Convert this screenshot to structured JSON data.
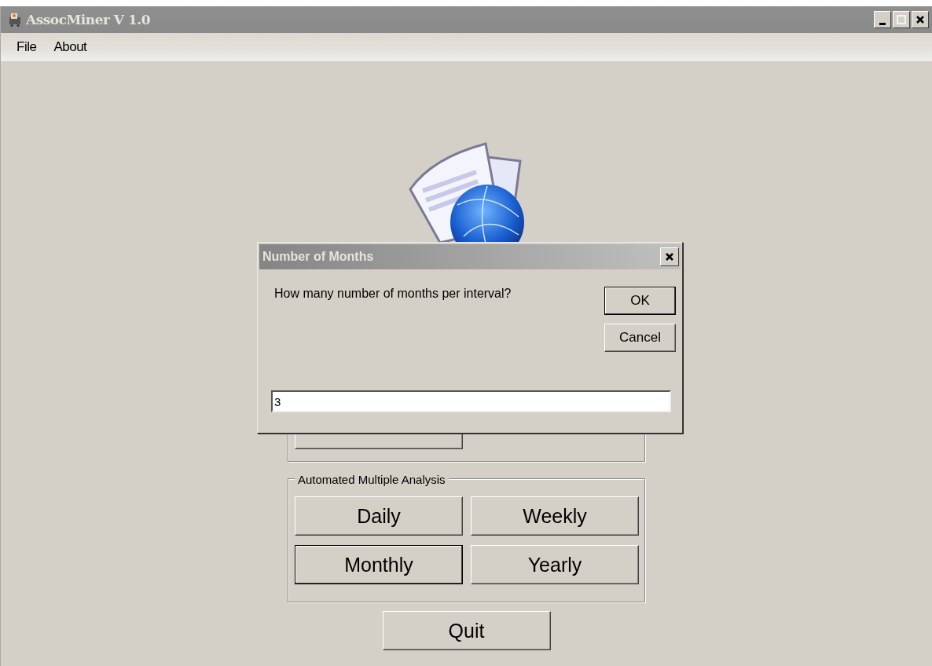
{
  "window": {
    "title": "AssocMiner V 1.0"
  },
  "menu": [
    "File",
    "About"
  ],
  "automated_group": {
    "title": "Automated Multiple Analysis",
    "buttons": [
      {
        "label": "Daily",
        "focused": false
      },
      {
        "label": "Weekly",
        "focused": false
      },
      {
        "label": "Monthly",
        "focused": true
      },
      {
        "label": "Yearly",
        "focused": false
      }
    ]
  },
  "quit_button": "Quit",
  "dialog": {
    "title": "Number of Months",
    "prompt": "How many number of months per interval?",
    "buttons": [
      {
        "label": "OK",
        "default": true
      },
      {
        "label": "Cancel",
        "default": false
      }
    ],
    "value": "3"
  }
}
